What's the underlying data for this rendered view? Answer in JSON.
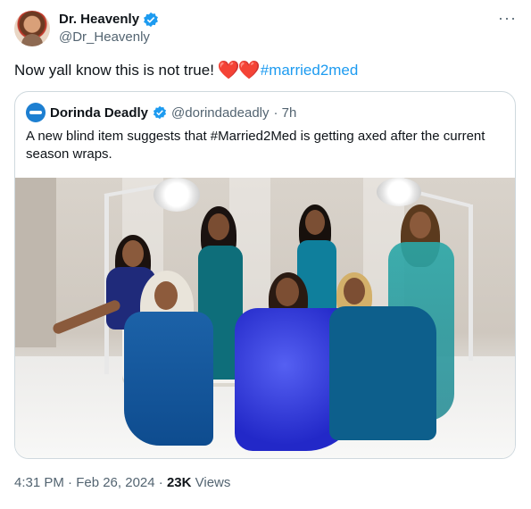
{
  "author": {
    "display_name": "Dr. Heavenly",
    "handle": "@Dr_Heavenly"
  },
  "more_icon": "more-horizontal-icon",
  "tweet": {
    "text": "Now yall know this is not true!",
    "emoji": "❤️❤️",
    "hashtag": "#married2med"
  },
  "quoted_tweet": {
    "display_name": "Dorinda Deadly",
    "handle": "@dorindadeadly",
    "time": "· 7h",
    "text": "A new blind item suggests that #Married2Med is getting axed after the current season wraps."
  },
  "footer": {
    "timestamp": "4:31 PM · Feb 26, 2024 · ",
    "views_count": "23K",
    "views_label": " Views"
  },
  "colors": {
    "accent": "#1d9bf0",
    "heart": "#e0202e",
    "secondary_text": "#536471"
  }
}
